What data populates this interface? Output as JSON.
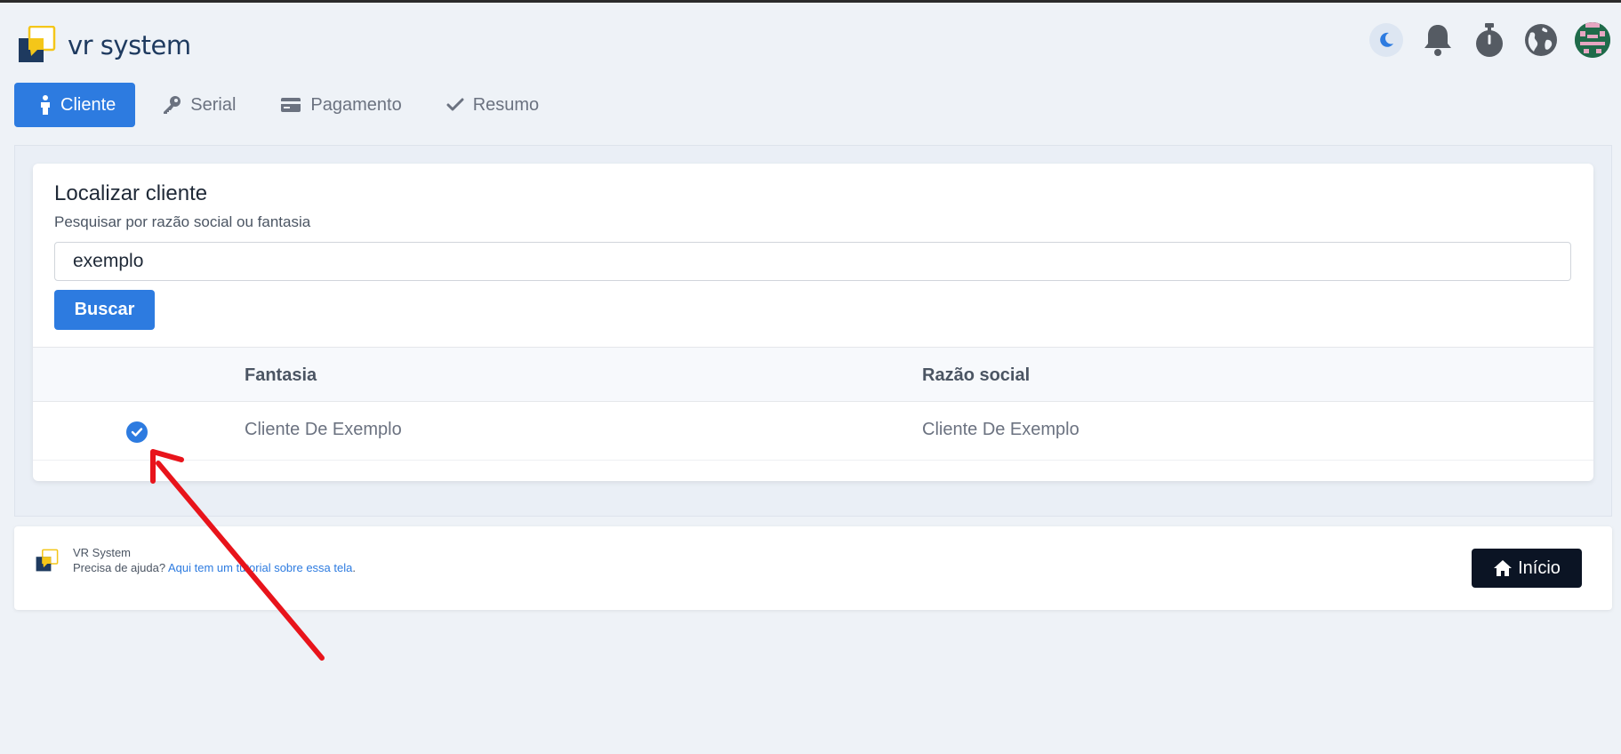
{
  "header": {
    "brand": "vr system",
    "icons": [
      "moon-icon",
      "bell-icon",
      "stopwatch-icon",
      "globe-icon",
      "avatar"
    ]
  },
  "tabs": [
    {
      "label": "Cliente",
      "icon": "person-icon",
      "active": true
    },
    {
      "label": "Serial",
      "icon": "key-icon",
      "active": false
    },
    {
      "label": "Pagamento",
      "icon": "credit-card-icon",
      "active": false
    },
    {
      "label": "Resumo",
      "icon": "check-icon",
      "active": false
    }
  ],
  "search_card": {
    "title": "Localizar cliente",
    "subtitle": "Pesquisar por razão social ou fantasia",
    "search_value": "exemplo",
    "button_label": "Buscar"
  },
  "table": {
    "headers": [
      "",
      "Fantasia",
      "Razão social"
    ],
    "rows": [
      {
        "selected": true,
        "fantasia": "Cliente De Exemplo",
        "razao_social": "Cliente De Exemplo"
      }
    ]
  },
  "footer": {
    "title": "VR System",
    "help_prefix": "Precisa de ajuda?",
    "help_link": "Aqui tem um tutorial sobre essa tela",
    "help_suffix": ".",
    "home_button": "Início"
  },
  "colors": {
    "primary": "#2d7be0",
    "brand_yellow": "#f4c619",
    "brand_navy": "#1e3a5f",
    "annotation_red": "#e8141b"
  }
}
